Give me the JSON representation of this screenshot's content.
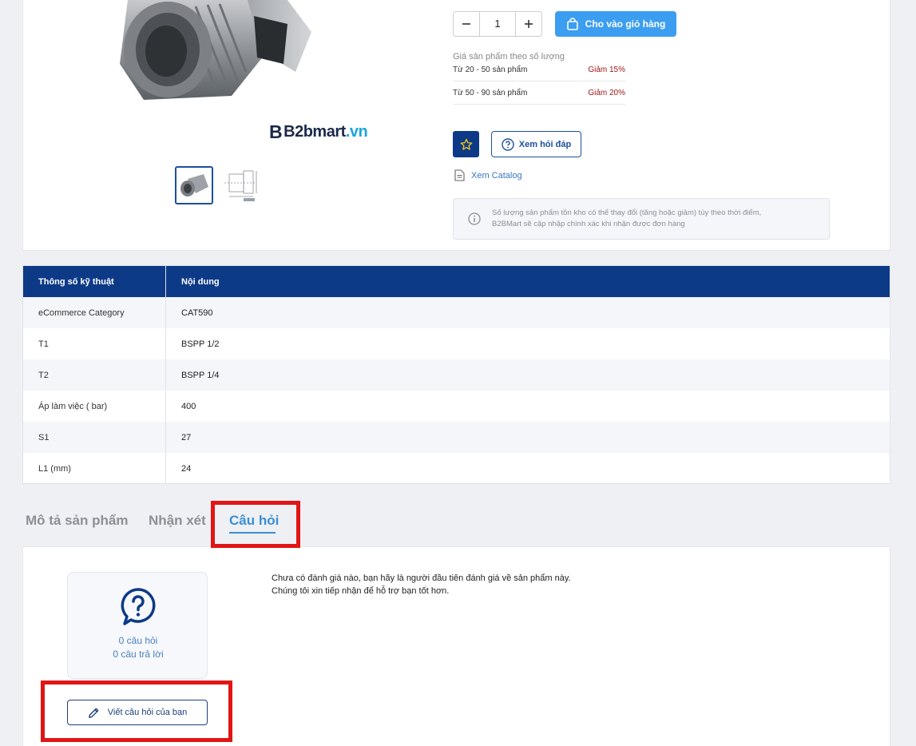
{
  "brand": {
    "logo_mark": "B",
    "name_dark": "B2bmart",
    "name_cyan": ".vn"
  },
  "quantity": {
    "value": "1",
    "minus": "−",
    "plus": "+"
  },
  "cart_button": {
    "label": "Cho vào giỏ hàng"
  },
  "price_tiers": {
    "title": "Giá sản phẩm theo số lượng",
    "rows": [
      {
        "qty": "Từ 20 - 50 sản phẩm",
        "discount": "Giảm 15%"
      },
      {
        "qty": "Từ 50 - 90 sản phẩm",
        "discount": "Giảm 20%"
      }
    ]
  },
  "actions": {
    "qa_label": "Xem hỏi đáp",
    "catalog_label": "Xem Catalog"
  },
  "notice": {
    "line1": "Số lượng sản phẩm tồn kho có thể thay đổi (tăng hoặc giảm) tùy theo thời điểm,",
    "line2": "B2BMart sẽ cập nhập chính xác khi nhận được đơn hàng"
  },
  "spec_table": {
    "headers": [
      "Thông số kỹ thuật",
      "Nội dung"
    ],
    "rows": [
      [
        "eCommerce Category",
        "CAT590"
      ],
      [
        "T1",
        "BSPP 1/2"
      ],
      [
        "T2",
        "BSPP 1/4"
      ],
      [
        "Áp làm việc ( bar)",
        "400"
      ],
      [
        "S1",
        "27"
      ],
      [
        "L1 (mm)",
        "24"
      ]
    ]
  },
  "tabs": [
    {
      "label": "Mô tả sản phẩm",
      "active": false
    },
    {
      "label": "Nhận xét",
      "active": false
    },
    {
      "label": "Câu hỏi",
      "active": true
    }
  ],
  "qa": {
    "question_count": "0 câu hỏi",
    "answer_count": "0 câu trả lời",
    "write_button": "Viết câu hỏi của bạn",
    "empty_line1": "Chưa có đánh giá nào, bạn hãy là người đầu tiên đánh giá về sản phẩm này.",
    "empty_line2": "Chúng tôi xin tiếp nhận để hỗ trợ bạn tốt hơn."
  },
  "colors": {
    "primary": "#0d3a87",
    "accent": "#3c9ef0",
    "highlight": "#e01616",
    "discount": "#a01818"
  },
  "icons": [
    "minus-icon",
    "plus-icon",
    "shopping-bag-icon",
    "star-icon",
    "question-circle-icon",
    "document-icon",
    "info-icon",
    "question-bubble-icon",
    "pencil-icon"
  ]
}
